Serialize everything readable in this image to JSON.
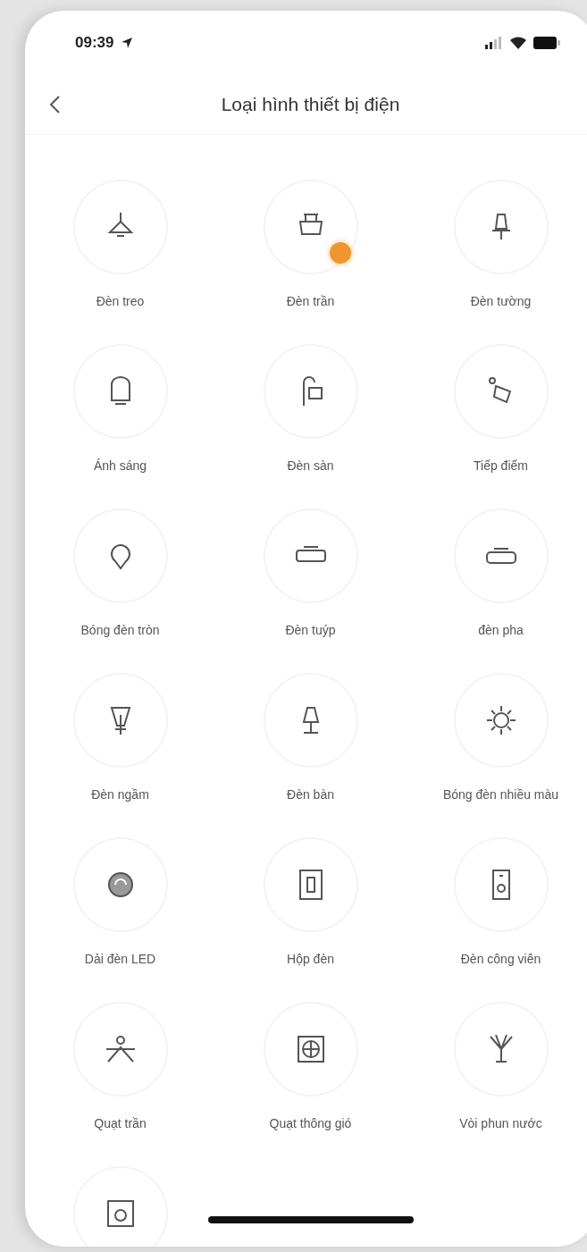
{
  "status_bar": {
    "time": "09:39"
  },
  "header": {
    "title": "Loại hình thiết bị điện"
  },
  "devices": [
    {
      "label": "Đèn treo",
      "badge": false
    },
    {
      "label": "Đèn trần",
      "badge": true
    },
    {
      "label": "Đèn tường",
      "badge": false
    },
    {
      "label": "Ánh sáng",
      "badge": false
    },
    {
      "label": "Đèn sàn",
      "badge": false
    },
    {
      "label": "Tiếp điểm",
      "badge": false
    },
    {
      "label": "Bóng đèn tròn",
      "badge": false
    },
    {
      "label": "Đèn tuýp",
      "badge": false
    },
    {
      "label": "đèn pha",
      "badge": false
    },
    {
      "label": "Đèn ngầm",
      "badge": false
    },
    {
      "label": "Đèn bàn",
      "badge": false
    },
    {
      "label": "Bóng đèn nhiều màu",
      "badge": false
    },
    {
      "label": "Dải đèn LED",
      "badge": false
    },
    {
      "label": "Hộp đèn",
      "badge": false
    },
    {
      "label": "Đèn công viên",
      "badge": false
    },
    {
      "label": "Quạt trần",
      "badge": false
    },
    {
      "label": "Quạt thông gió",
      "badge": false
    },
    {
      "label": "Vòi phun nước",
      "badge": false
    },
    {
      "badge": false
    }
  ]
}
